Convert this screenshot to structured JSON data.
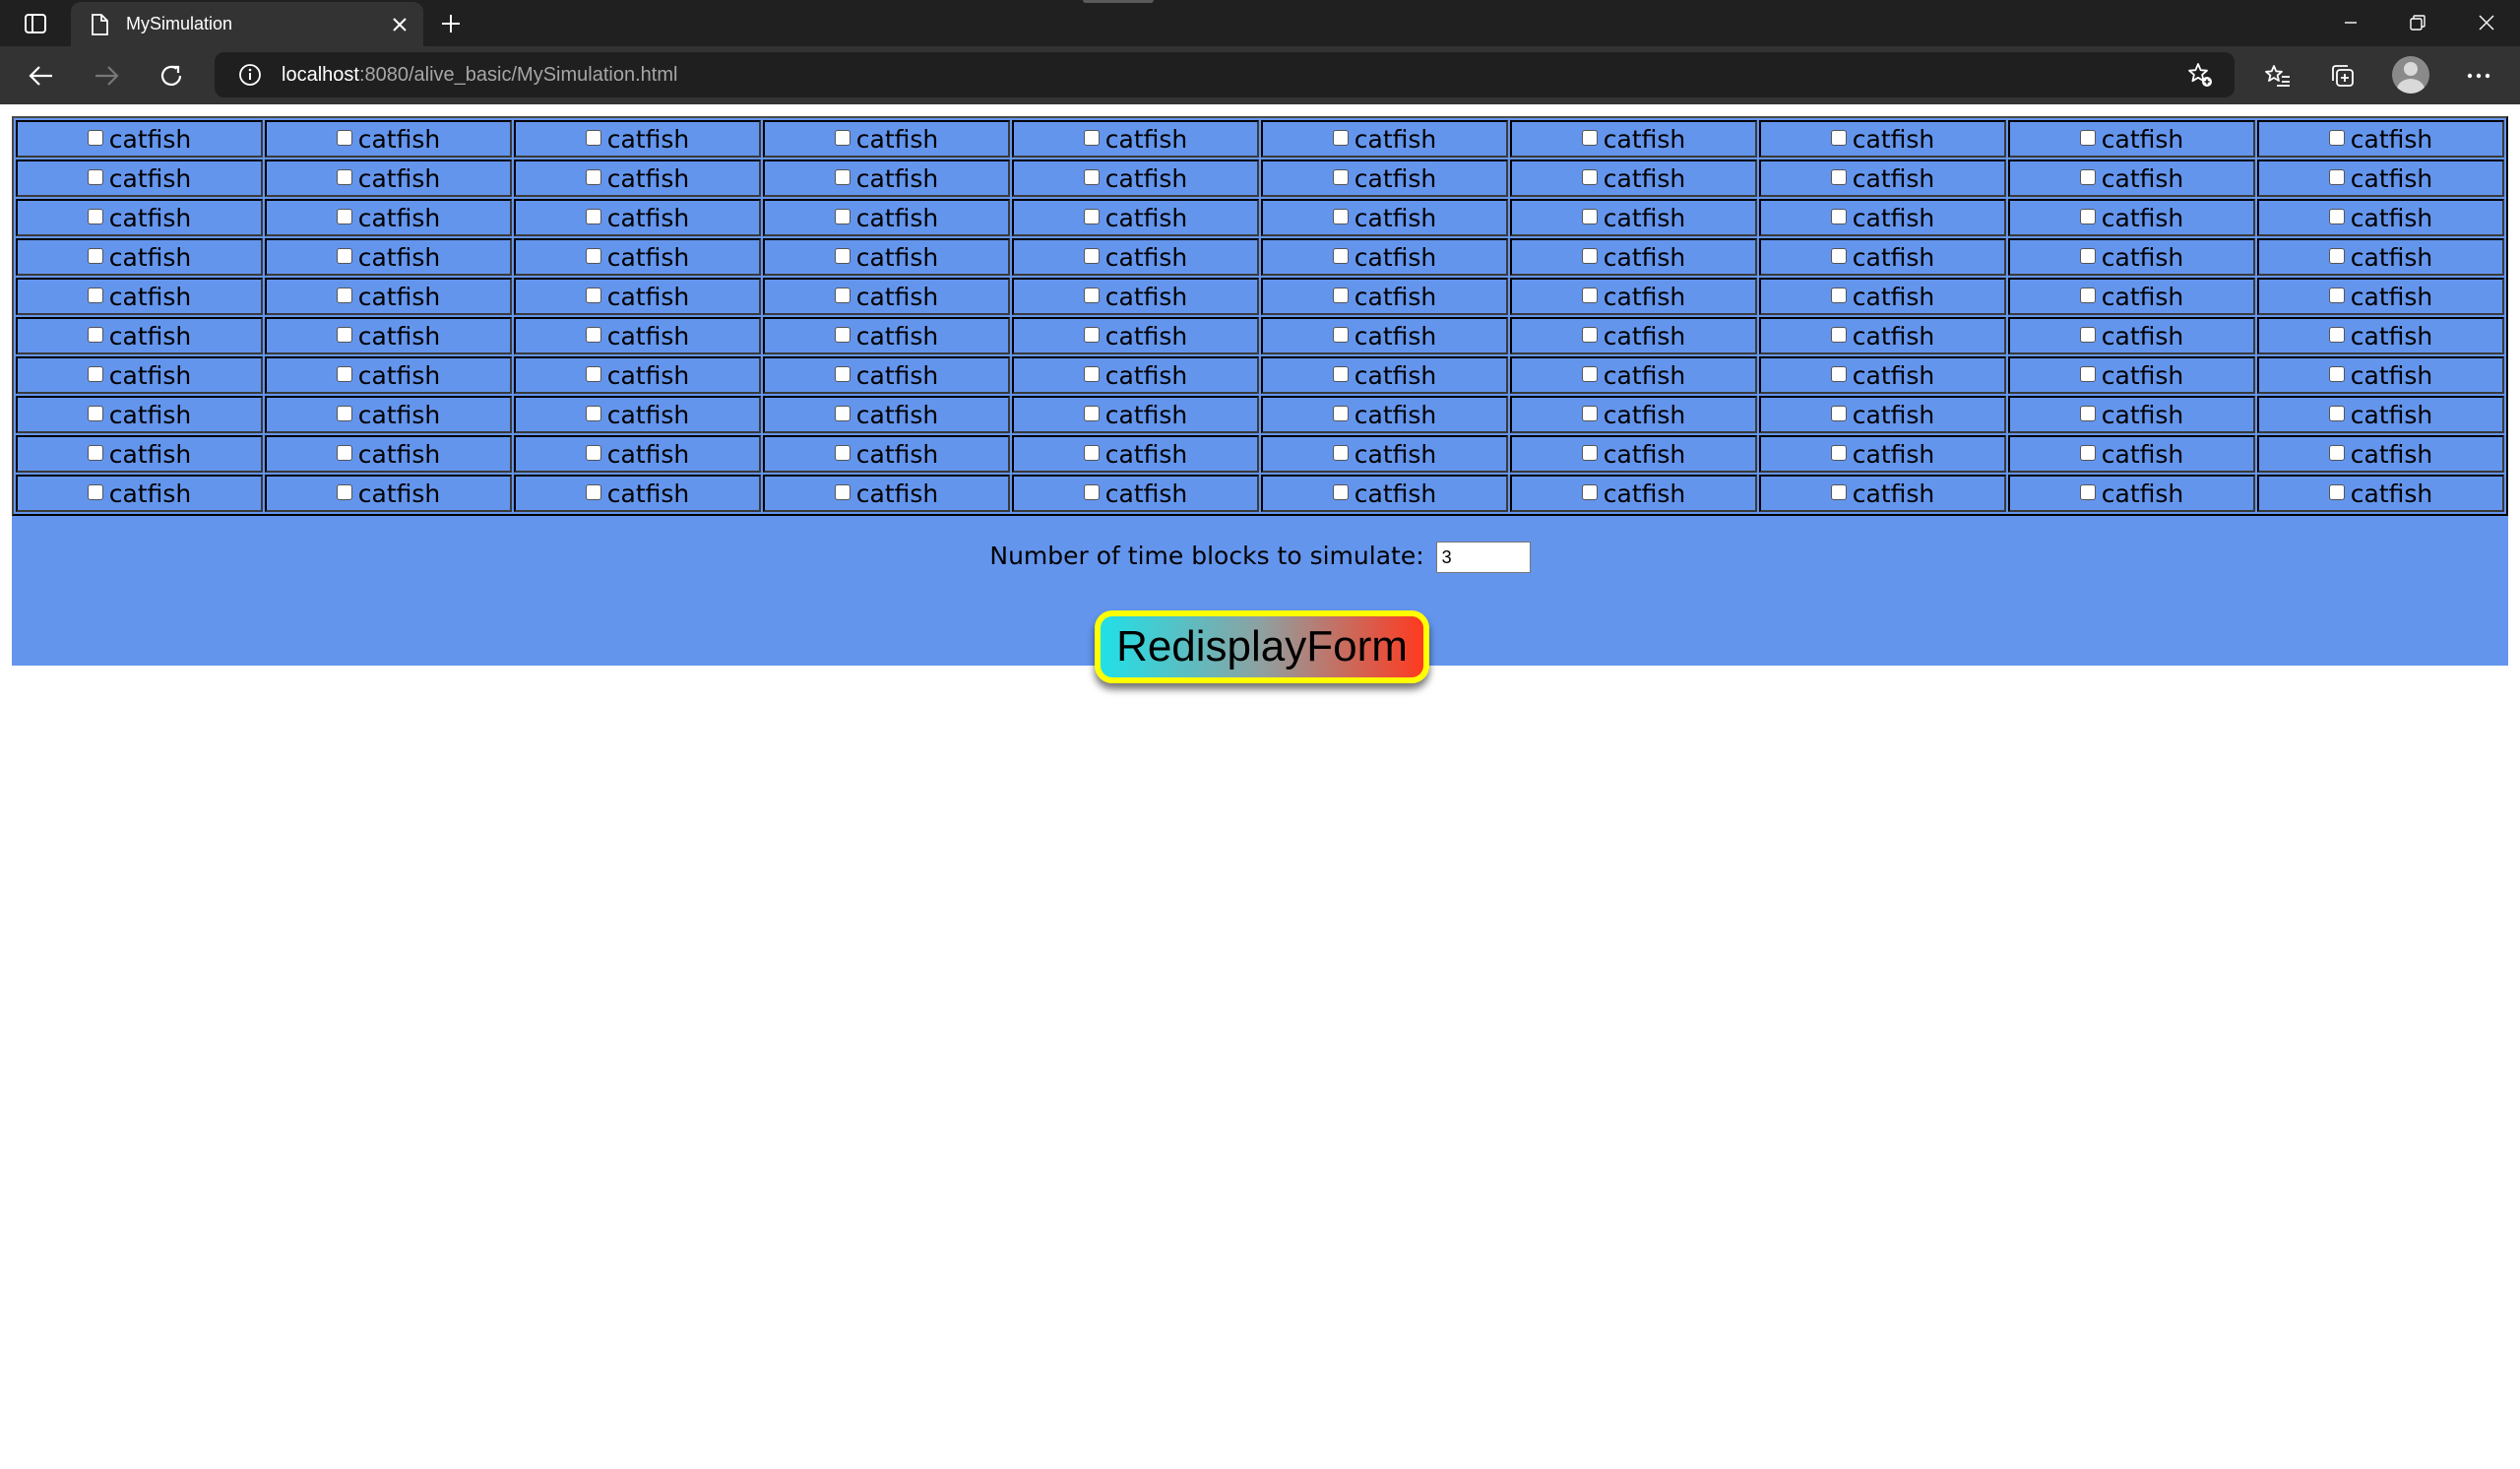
{
  "browser": {
    "tab_title": "MySimulation",
    "url_host": "localhost",
    "url_rest": ":8080/alive_basic/MySimulation.html"
  },
  "grid": {
    "rows": 10,
    "cols": 10,
    "cell_label": "catfish",
    "checked": false
  },
  "simulation": {
    "label": "Number of time blocks to simulate:",
    "value": "3"
  },
  "redisplay_button": {
    "label": "RedisplayForm"
  },
  "colors": {
    "panel_background": "#6495ed",
    "button_border": "#ffff00",
    "button_gradient_start": "#20e0e8",
    "button_gradient_end": "#ff3a20"
  }
}
